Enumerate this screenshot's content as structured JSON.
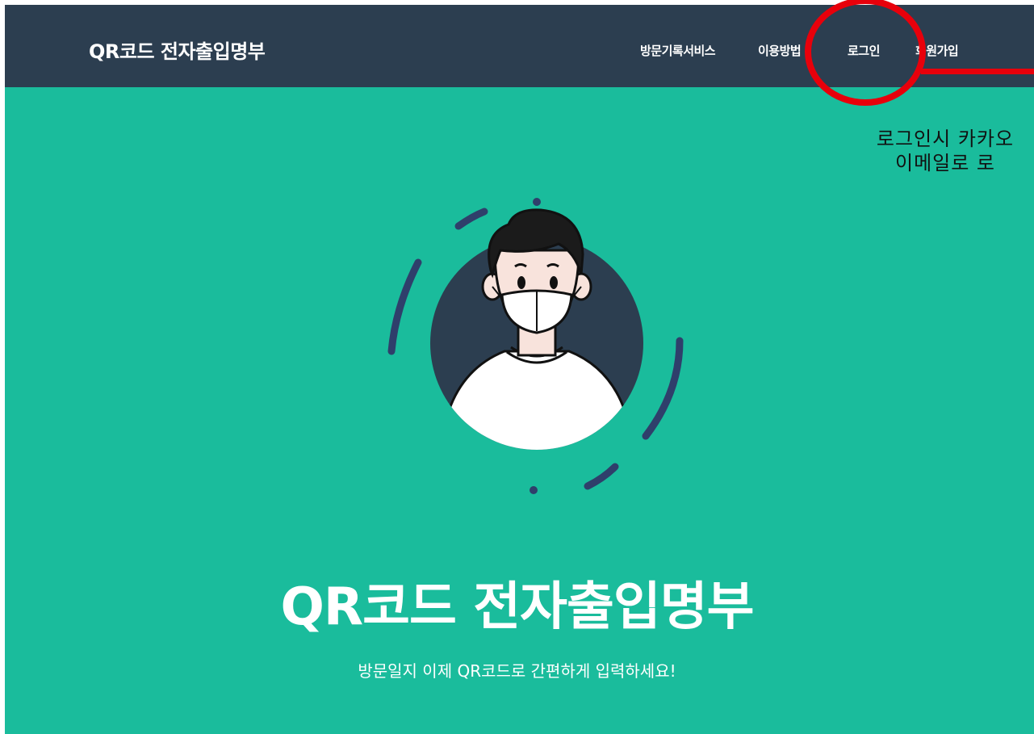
{
  "navbar": {
    "brand": "QR코드 전자출입명부",
    "items": [
      {
        "label": "방문기록서비스"
      },
      {
        "label": "이용방법"
      },
      {
        "label": "로그인"
      },
      {
        "label": "회원가입"
      }
    ]
  },
  "annotation": {
    "line1": "로그인시 카카오",
    "line2": "이메일로 로"
  },
  "hero": {
    "title": "QR코드 전자출입명부",
    "subtitle": "방문일지 이제 QR코드로 간편하게 입력하세요!"
  },
  "colors": {
    "navbar_bg": "#2c3e50",
    "hero_bg": "#1abc9c",
    "annotation": "#e8000b",
    "text": "#ffffff"
  },
  "icons": {
    "avatar": "masked-person-illustration"
  }
}
